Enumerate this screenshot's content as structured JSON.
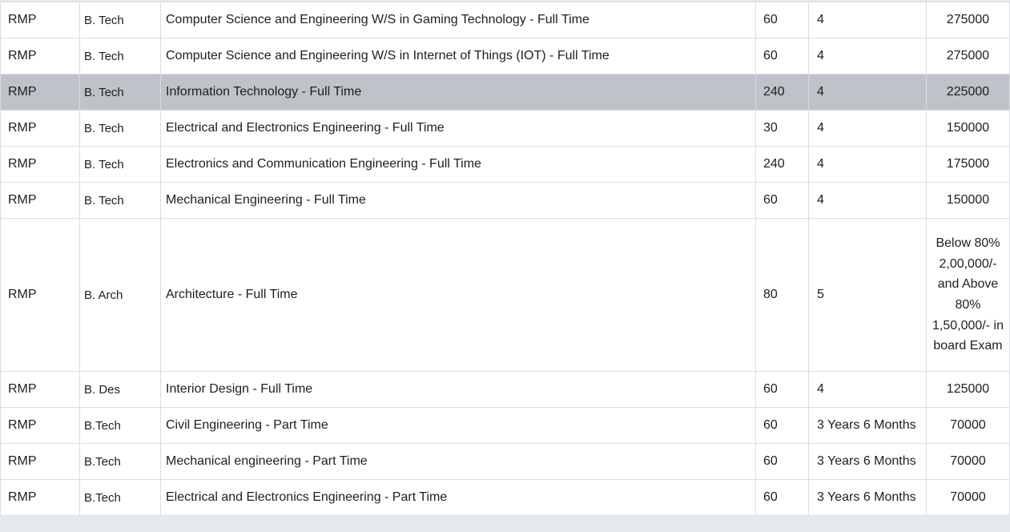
{
  "table": {
    "rows": [
      {
        "campus": "RMP",
        "degree": "B. Tech",
        "course": "Computer Science and Engineering W/S in Gaming Technology - Full Time",
        "intake": "60",
        "duration": "4",
        "fee": "275000"
      },
      {
        "campus": "RMP",
        "degree": "B. Tech",
        "course": "Computer Science and Engineering W/S in Internet of Things (IOT) - Full Time",
        "intake": "60",
        "duration": "4",
        "fee": "275000"
      },
      {
        "campus": "RMP",
        "degree": "B. Tech",
        "course": "Information Technology - Full Time",
        "intake": "240",
        "duration": "4",
        "fee": "225000"
      },
      {
        "campus": "RMP",
        "degree": "B. Tech",
        "course": "Electrical and Electronics Engineering - Full Time",
        "intake": "30",
        "duration": "4",
        "fee": "150000"
      },
      {
        "campus": "RMP",
        "degree": "B. Tech",
        "course": "Electronics and Communication Engineering - Full Time",
        "intake": "240",
        "duration": "4",
        "fee": "175000"
      },
      {
        "campus": "RMP",
        "degree": "B. Tech",
        "course": "Mechanical Engineering - Full Time",
        "intake": "60",
        "duration": "4",
        "fee": "150000"
      },
      {
        "campus": "RMP",
        "degree": "B. Arch",
        "course": "Architecture - Full Time",
        "intake": "80",
        "duration": "5",
        "fee": "Below 80% 2,00,000/- and Above 80% 1,50,000/- in board Exam"
      },
      {
        "campus": "RMP",
        "degree": "B. Des",
        "course": "Interior Design - Full Time",
        "intake": "60",
        "duration": "4",
        "fee": "125000"
      },
      {
        "campus": "RMP",
        "degree": "B.Tech",
        "course": "Civil Engineering - Part Time",
        "intake": "60",
        "duration": "3 Years 6 Months",
        "fee": "70000"
      },
      {
        "campus": "RMP",
        "degree": "B.Tech",
        "course": "Mechanical engineering - Part Time",
        "intake": "60",
        "duration": "3 Years 6 Months",
        "fee": "70000"
      },
      {
        "campus": "RMP",
        "degree": "B.Tech",
        "course": "Electrical and Electronics Engineering - Part Time",
        "intake": "60",
        "duration": "3 Years 6 Months",
        "fee": "70000"
      }
    ]
  },
  "colors": {
    "highlight_row": "#bdc3c9",
    "border": "#d9dcdf",
    "background": "#ffffff"
  }
}
